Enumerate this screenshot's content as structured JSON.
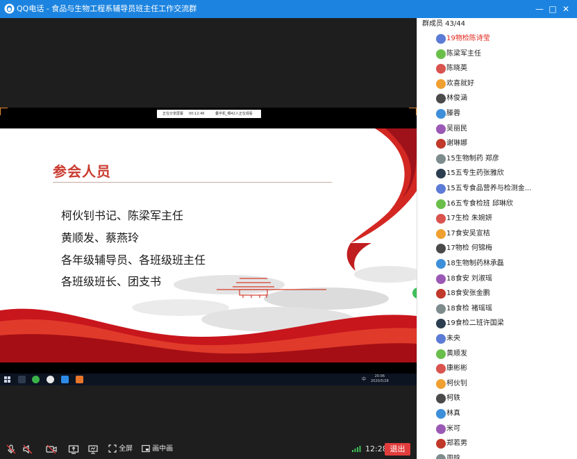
{
  "window": {
    "title": "QQ电话 - 食品与生物工程系辅导员班主任工作交流群",
    "minimize_glyph": "—",
    "maximize_glyph": "□",
    "close_glyph": "✕"
  },
  "screen_share": {
    "strip_text_1": "正在分享屏幕",
    "strip_time": "00:12:46",
    "strip_text_2": "叠字机_哪42人正在观看",
    "slide": {
      "title": "参会人员",
      "lines": [
        "柯伙钊书记、陈梁军主任",
        "黄顺发、蔡燕玲",
        "各年级辅导员、各班级班主任",
        "各班级班长、团支书"
      ]
    },
    "taskbar": {
      "ime": "中",
      "time": "20:06",
      "date": "2020/5/28"
    }
  },
  "controls": {
    "fullscreen_label": "全屏",
    "pip_label": "画中画",
    "call_time": "12:28",
    "hangup_label": "退出"
  },
  "members_panel": {
    "header": "群成员 43/44",
    "members": [
      {
        "name": "19物检陈诗莹",
        "active": true
      },
      {
        "name": "陈梁军主任"
      },
      {
        "name": "陈晓英"
      },
      {
        "name": "欢喜就好"
      },
      {
        "name": "林俊涵"
      },
      {
        "name": "滕蓉"
      },
      {
        "name": "吴丽民"
      },
      {
        "name": "谢琳娜"
      },
      {
        "name": "15生物制药  郑彦"
      },
      {
        "name": "15五专生药张雅欣"
      },
      {
        "name": "15五专食品营养与检测金..."
      },
      {
        "name": "16五专食检班 邱琳欣"
      },
      {
        "name": "17生检 朱婉妍"
      },
      {
        "name": "17食安吴宣桔"
      },
      {
        "name": "17物检 何锦梅"
      },
      {
        "name": "18生物制药林承磊"
      },
      {
        "name": "18食安  刘淑瑶"
      },
      {
        "name": "18食安张金鹏"
      },
      {
        "name": "18食检  褚瑶瑶"
      },
      {
        "name": "19食检二班许国梁"
      },
      {
        "name": "未央"
      },
      {
        "name": "黄顺发"
      },
      {
        "name": "康彬彬"
      },
      {
        "name": "柯伙钊"
      },
      {
        "name": "柯轶"
      },
      {
        "name": "林真"
      },
      {
        "name": "米可"
      },
      {
        "name": "郑若男"
      },
      {
        "name": "周晗"
      }
    ]
  },
  "colors": {
    "titlebar": "#1c84e0",
    "accent_red": "#e1251b",
    "slide_title": "#c93a2e",
    "hangup": "#e13c3c"
  }
}
